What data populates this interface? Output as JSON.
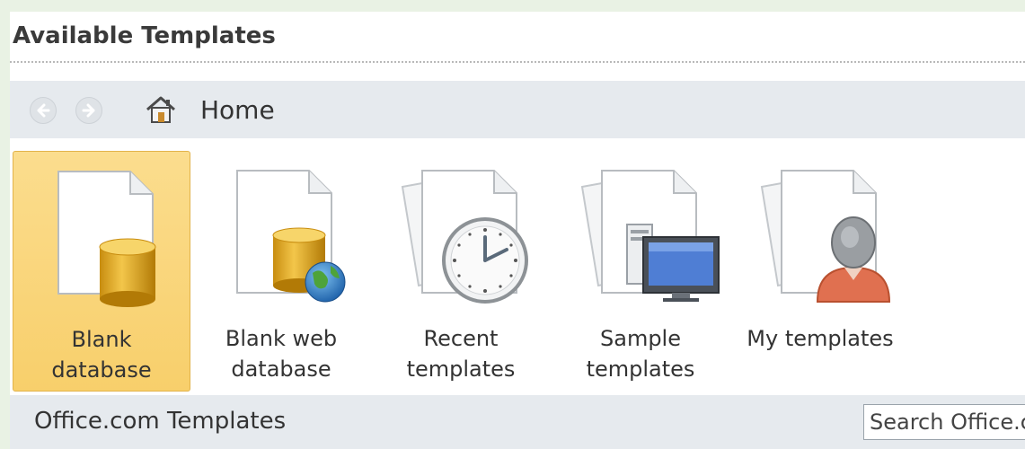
{
  "header": {
    "title": "Available Templates"
  },
  "nav": {
    "location": "Home"
  },
  "templates": [
    {
      "label_line1": "Blank",
      "label_line2": "database",
      "icon": "blank-database-icon",
      "selected": true
    },
    {
      "label_line1": "Blank web",
      "label_line2": "database",
      "icon": "blank-web-database-icon",
      "selected": false
    },
    {
      "label_line1": "Recent",
      "label_line2": "templates",
      "icon": "recent-templates-icon",
      "selected": false
    },
    {
      "label_line1": "Sample",
      "label_line2": "templates",
      "icon": "sample-templates-icon",
      "selected": false
    },
    {
      "label_line1": "My templates",
      "label_line2": "",
      "icon": "my-templates-icon",
      "selected": false
    }
  ],
  "office": {
    "title": "Office.com Templates",
    "search_placeholder": "Search Office.com"
  },
  "colors": {
    "selected_tile": "#f8cf6b",
    "nav_bar": "#e6eaee",
    "background": "#e9f2e4"
  }
}
